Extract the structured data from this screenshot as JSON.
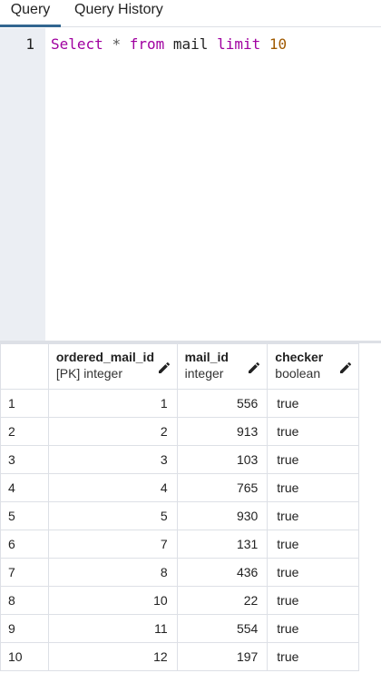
{
  "tabs": [
    {
      "label": "Query"
    },
    {
      "label": "Query History"
    }
  ],
  "editor": {
    "line_number": "1",
    "tokens": {
      "select": "Select",
      "star": "*",
      "from": "from",
      "table": "mail",
      "limit": "limit",
      "count": "10"
    }
  },
  "grid": {
    "columns": [
      {
        "name": "ordered_mail_id",
        "type": "[PK] integer"
      },
      {
        "name": "mail_id",
        "type": "integer"
      },
      {
        "name": "checker",
        "type": "boolean"
      }
    ],
    "rows": [
      {
        "n": "1",
        "ordered_mail_id": "1",
        "mail_id": "556",
        "checker": "true"
      },
      {
        "n": "2",
        "ordered_mail_id": "2",
        "mail_id": "913",
        "checker": "true"
      },
      {
        "n": "3",
        "ordered_mail_id": "3",
        "mail_id": "103",
        "checker": "true"
      },
      {
        "n": "4",
        "ordered_mail_id": "4",
        "mail_id": "765",
        "checker": "true"
      },
      {
        "n": "5",
        "ordered_mail_id": "5",
        "mail_id": "930",
        "checker": "true"
      },
      {
        "n": "6",
        "ordered_mail_id": "7",
        "mail_id": "131",
        "checker": "true"
      },
      {
        "n": "7",
        "ordered_mail_id": "8",
        "mail_id": "436",
        "checker": "true"
      },
      {
        "n": "8",
        "ordered_mail_id": "10",
        "mail_id": "22",
        "checker": "true"
      },
      {
        "n": "9",
        "ordered_mail_id": "11",
        "mail_id": "554",
        "checker": "true"
      },
      {
        "n": "10",
        "ordered_mail_id": "12",
        "mail_id": "197",
        "checker": "true"
      }
    ]
  },
  "icons": {
    "edit_column": "pencil-icon"
  },
  "colors": {
    "accent": "#326690",
    "keyword": "#a000a0",
    "number": "#a05a00",
    "gutter": "#ebeef3"
  }
}
